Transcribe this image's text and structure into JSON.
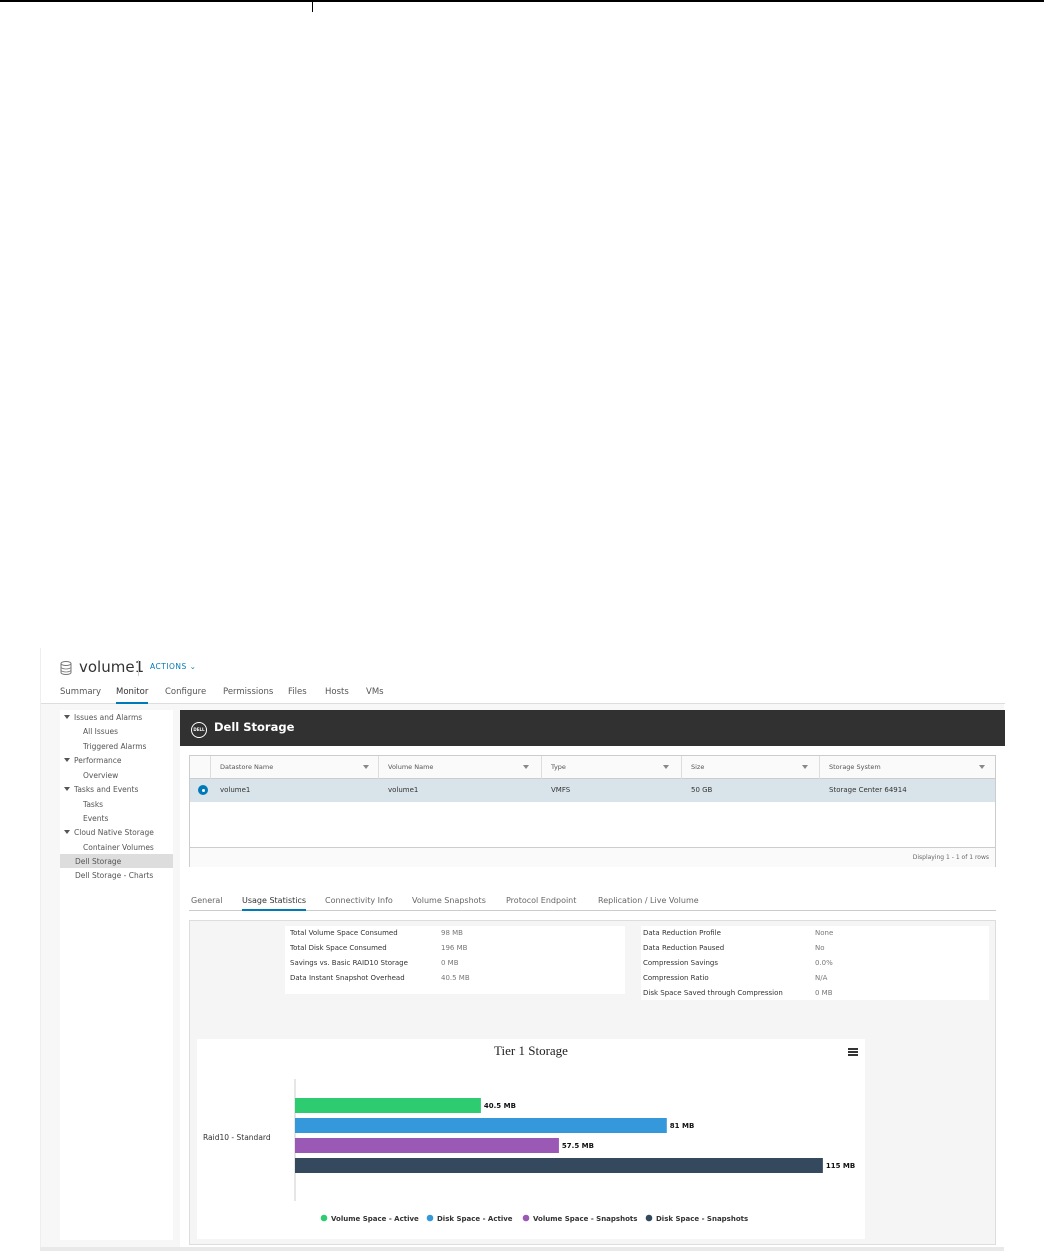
{
  "header": {
    "title": "volume1",
    "actions_label": "ACTIONS ⌄",
    "tabs": [
      "Summary",
      "Monitor",
      "Configure",
      "Permissions",
      "Files",
      "Hosts",
      "VMs"
    ],
    "active_tab": "Monitor"
  },
  "sidebar": {
    "items": [
      {
        "label": "Issues and Alarms"
      },
      {
        "label": "All Issues"
      },
      {
        "label": "Triggered Alarms"
      },
      {
        "label": "Performance"
      },
      {
        "label": "Overview"
      },
      {
        "label": "Tasks and Events"
      },
      {
        "label": "Tasks"
      },
      {
        "label": "Events"
      },
      {
        "label": "Cloud Native Storage"
      },
      {
        "label": "Container Volumes"
      },
      {
        "label": "Dell Storage"
      },
      {
        "label": "Dell Storage - Charts"
      }
    ],
    "selected": "Dell Storage"
  },
  "banner": {
    "logo_text": "DELL",
    "title": "Dell Storage"
  },
  "grid": {
    "columns": [
      "Datastore Name",
      "Volume Name",
      "Type",
      "Size",
      "Storage System"
    ],
    "rows": [
      [
        "volume1",
        "volume1",
        "VMFS",
        "50 GB",
        "Storage Center 64914"
      ]
    ],
    "footer": "Displaying 1 - 1 of 1 rows"
  },
  "subtabs": {
    "items": [
      "General",
      "Usage Statistics",
      "Connectivity Info",
      "Volume Snapshots",
      "Protocol Endpoint",
      "Replication / Live Volume"
    ],
    "active": "Usage Statistics"
  },
  "stats_left": [
    {
      "label": "Total Volume Space Consumed",
      "value": "98 MB"
    },
    {
      "label": "Total Disk Space Consumed",
      "value": "196 MB"
    },
    {
      "label": "Savings vs. Basic RAID10 Storage",
      "value": "0 MB"
    },
    {
      "label": "Data Instant Snapshot Overhead",
      "value": "40.5 MB"
    }
  ],
  "stats_right": [
    {
      "label": "Data Reduction Profile",
      "value": "None"
    },
    {
      "label": "Data Reduction Paused",
      "value": "No"
    },
    {
      "label": "Compression Savings",
      "value": "0.0%"
    },
    {
      "label": "Compression Ratio",
      "value": "N/A"
    },
    {
      "label": "Disk Space Saved through Compression",
      "value": "0 MB"
    }
  ],
  "chart_data": {
    "type": "bar",
    "orientation": "horizontal",
    "title": "Tier 1 Storage",
    "categories": [
      "Raid10 - Standard"
    ],
    "series": [
      {
        "name": "Volume Space - Active",
        "values": [
          40.5
        ],
        "label": "40.5 MB",
        "color": "#2ecc71"
      },
      {
        "name": "Disk Space - Active",
        "values": [
          81
        ],
        "label": "81 MB",
        "color": "#3498db"
      },
      {
        "name": "Volume Space - Snapshots",
        "values": [
          57.5
        ],
        "label": "57.5 MB",
        "color": "#9b59b6"
      },
      {
        "name": "Disk Space - Snapshots",
        "values": [
          115
        ],
        "label": "115 MB",
        "color": "#34495e"
      }
    ],
    "xlim": [
      0,
      122
    ],
    "unit": "MB",
    "grid": false,
    "legend": "bottom"
  }
}
